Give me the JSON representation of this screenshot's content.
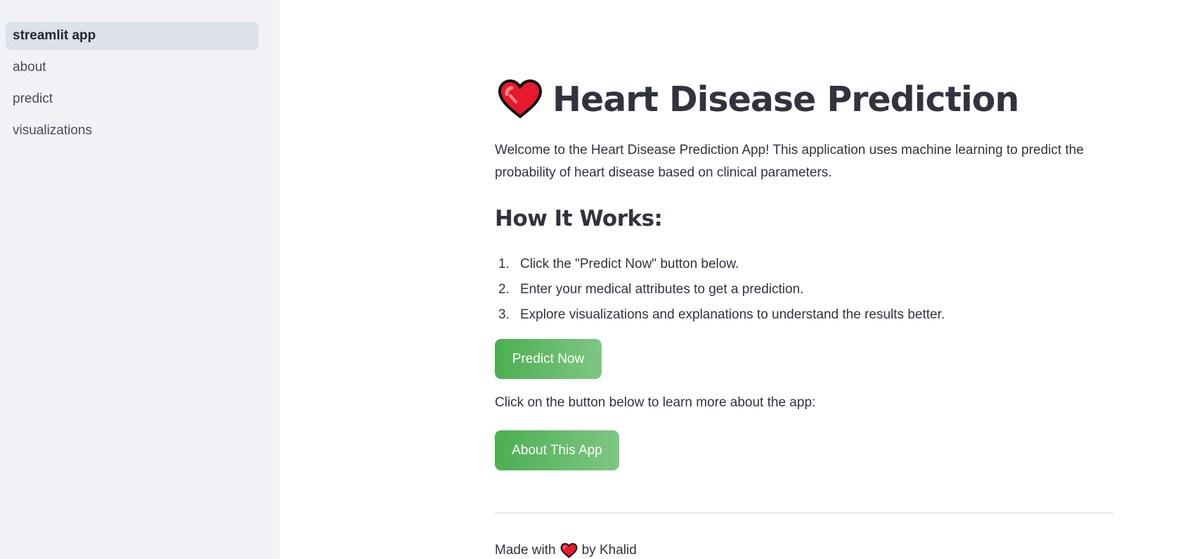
{
  "sidebar": {
    "items": [
      {
        "label": "streamlit app",
        "active": true
      },
      {
        "label": "about",
        "active": false
      },
      {
        "label": "predict",
        "active": false
      },
      {
        "label": "visualizations",
        "active": false
      }
    ]
  },
  "main": {
    "title_icon": "heart-icon",
    "title": "Heart Disease Prediction",
    "intro": "Welcome to the Heart Disease Prediction App! This application uses machine learning to predict the probability of heart disease based on clinical parameters.",
    "how_heading": "How It Works:",
    "steps": [
      {
        "num": "1.",
        "text": "Click the \"Predict Now\" button below."
      },
      {
        "num": "2.",
        "text": "Enter your medical attributes to get a prediction."
      },
      {
        "num": "3.",
        "text": "Explore visualizations and explanations to understand the results better."
      }
    ],
    "predict_button": "Predict Now",
    "learn_text": "Click on the button below to learn more about the app:",
    "about_button": "About This App",
    "footer_prefix": "Made with",
    "footer_icon": "heart-icon",
    "footer_suffix": "by Khalid"
  },
  "colors": {
    "sidebar_bg": "#f0f2f6",
    "button_start": "#4caf50",
    "button_end": "#7ec684",
    "text": "#31333f",
    "heart": "#e8192c"
  }
}
